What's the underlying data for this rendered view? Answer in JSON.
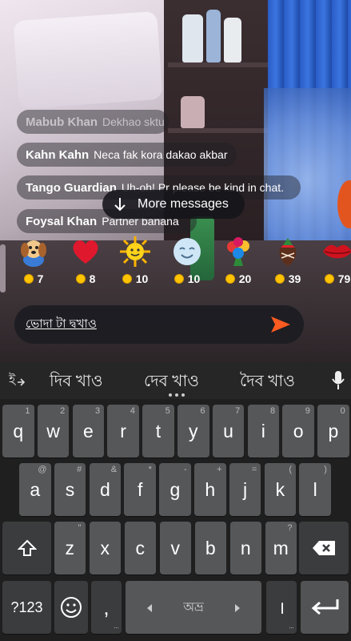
{
  "chat": {
    "messages": [
      {
        "user": "Mabub Khan",
        "text": "Dekhao sktu"
      },
      {
        "user": "Kahn Kahn",
        "text": "Neca fak kora dakao akbar"
      },
      {
        "user": "Tango Guardian",
        "text": "Uh-oh! Pr please be kind in chat."
      },
      {
        "user": "Foysal Khan",
        "text": "Partner banana"
      }
    ],
    "more_messages_label": "More messages"
  },
  "gifts": [
    {
      "icon": "puppy-icon",
      "price": "7"
    },
    {
      "icon": "heart-icon",
      "price": "8"
    },
    {
      "icon": "sun-icon",
      "price": "10"
    },
    {
      "icon": "smiley-face-icon",
      "price": "10"
    },
    {
      "icon": "flower-bouquet-icon",
      "price": "20"
    },
    {
      "icon": "chocolate-strawberry-icon",
      "price": "39"
    },
    {
      "icon": "lips-icon",
      "price": "79"
    }
  ],
  "input": {
    "value": "ভোদা টা দ্বখাও"
  },
  "keyboard": {
    "suggestions": [
      "দিব খাও",
      "দেব খাও",
      "দৈব খাও"
    ],
    "row1": [
      {
        "key": "q",
        "hint": "1"
      },
      {
        "key": "w",
        "hint": "2"
      },
      {
        "key": "e",
        "hint": "3"
      },
      {
        "key": "r",
        "hint": "4"
      },
      {
        "key": "t",
        "hint": "5"
      },
      {
        "key": "y",
        "hint": "6"
      },
      {
        "key": "u",
        "hint": "7"
      },
      {
        "key": "i",
        "hint": "8"
      },
      {
        "key": "o",
        "hint": "9"
      },
      {
        "key": "p",
        "hint": "0"
      }
    ],
    "row2": [
      {
        "key": "a",
        "hint": "@"
      },
      {
        "key": "s",
        "hint": "#"
      },
      {
        "key": "d",
        "hint": "&"
      },
      {
        "key": "f",
        "hint": "*"
      },
      {
        "key": "g",
        "hint": "-"
      },
      {
        "key": "h",
        "hint": "+"
      },
      {
        "key": "j",
        "hint": "="
      },
      {
        "key": "k",
        "hint": "("
      },
      {
        "key": "l",
        "hint": ")"
      }
    ],
    "row3": [
      {
        "key": "z",
        "hint": "\""
      },
      {
        "key": "x",
        "hint": ""
      },
      {
        "key": "c",
        "hint": ""
      },
      {
        "key": "v",
        "hint": ""
      },
      {
        "key": "b",
        "hint": ""
      },
      {
        "key": "n",
        "hint": ""
      },
      {
        "key": "m",
        "hint": "?"
      }
    ],
    "symbols_label": "?123",
    "comma_label": ",",
    "space_label": "অভ্র",
    "period_label": "।"
  },
  "colors": {
    "send": "#ff5a1f",
    "coin": "#ffc400",
    "key": "#555759",
    "keyboard_bg": "#1f1f1f"
  }
}
